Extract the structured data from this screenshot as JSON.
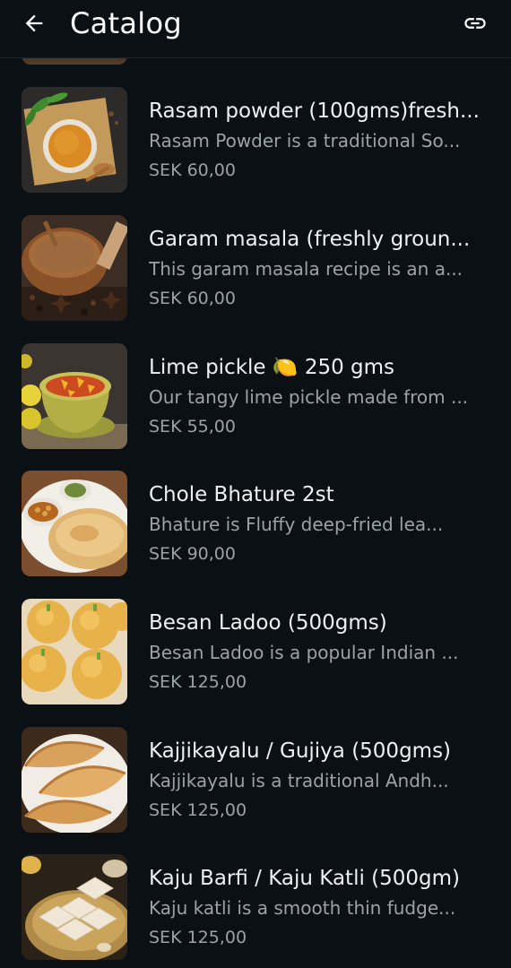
{
  "header": {
    "title": "Catalog",
    "back_icon": "arrow-left-icon",
    "link_icon": "link-icon"
  },
  "products": [
    {
      "name": "Rasam powder (100gms)fresh...",
      "description": "Rasam Powder is a traditional So...",
      "price": "SEK 60,00"
    },
    {
      "name": "Garam masala (freshly groun...",
      "description": "This garam masala recipe is an a...",
      "price": "SEK 60,00"
    },
    {
      "name": "Lime pickle 🍋 250 gms",
      "description": "Our tangy lime pickle made from ...",
      "price": "SEK 55,00"
    },
    {
      "name": "Chole Bhature 2st",
      "description": "Bhature is Fluffy deep-fried lea...",
      "price": "SEK 90,00"
    },
    {
      "name": "Besan Ladoo (500gms)",
      "description": "Besan Ladoo is a popular Indian ...",
      "price": "SEK 125,00"
    },
    {
      "name": "Kajjikayalu / Gujiya (500gms)",
      "description": "Kajjikayalu is a traditional Andh...",
      "price": "SEK 125,00"
    },
    {
      "name": "Kaju Barfi / Kaju Katli (500gm)",
      "description": "Kaju katli is a smooth thin fudge...",
      "price": "SEK 125,00"
    }
  ]
}
